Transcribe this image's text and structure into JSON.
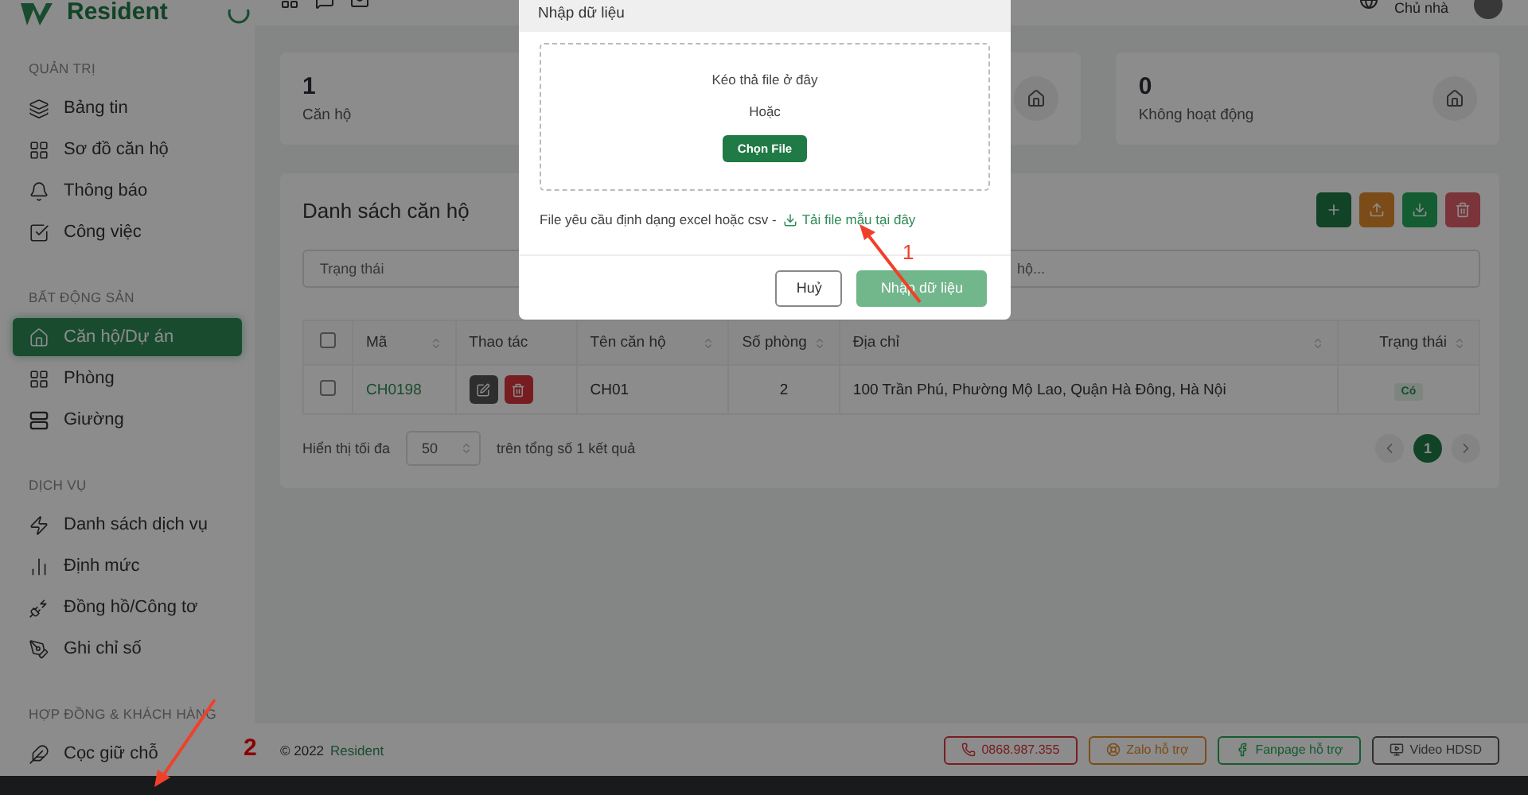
{
  "brand": {
    "name": "Resident"
  },
  "header": {
    "user_role": "Chủ nhà"
  },
  "sidebar": {
    "sections": [
      {
        "title": "QUẢN TRỊ",
        "items": [
          {
            "label": "Bảng tin",
            "selected": false
          },
          {
            "label": "Sơ đồ căn hộ",
            "selected": false
          },
          {
            "label": "Thông báo",
            "selected": false
          },
          {
            "label": "Công việc",
            "selected": false
          }
        ]
      },
      {
        "title": "BẤT ĐỘNG SẢN",
        "items": [
          {
            "label": "Căn hộ/Dự án",
            "selected": true
          },
          {
            "label": "Phòng",
            "selected": false
          },
          {
            "label": "Giường",
            "selected": false
          }
        ]
      },
      {
        "title": "DỊCH VỤ",
        "items": [
          {
            "label": "Danh sách dịch vụ",
            "selected": false
          },
          {
            "label": "Định mức",
            "selected": false
          },
          {
            "label": "Đồng hồ/Công tơ",
            "selected": false
          },
          {
            "label": "Ghi chỉ số",
            "selected": false
          }
        ]
      },
      {
        "title": "HỢP ĐỒNG & KHÁCH HÀNG",
        "items": [
          {
            "label": "Cọc giữ chỗ",
            "selected": false
          }
        ]
      }
    ]
  },
  "stats": [
    {
      "value": "1",
      "label": "Căn hộ"
    },
    {
      "value": "0",
      "label": "Không hoạt động"
    }
  ],
  "list": {
    "title": "Danh sách căn hộ",
    "actions": [
      {
        "kind": "add"
      },
      {
        "kind": "upload"
      },
      {
        "kind": "download"
      },
      {
        "kind": "delete"
      }
    ],
    "filter": {
      "placeholder": "Trạng thái"
    },
    "search": {
      "placeholder": "hộ..."
    },
    "columns": [
      {
        "label": "Mã",
        "sortable": true
      },
      {
        "label": "Thao tác",
        "sortable": false
      },
      {
        "label": "Tên căn hộ",
        "sortable": true
      },
      {
        "label": "Số phòng",
        "sortable": true
      },
      {
        "label": "Địa chỉ",
        "sortable": true
      },
      {
        "label": "Trạng thái",
        "sortable": true
      }
    ],
    "header_checked": false,
    "rows": [
      {
        "checked": false,
        "code": "CH0198",
        "name": "CH01",
        "rooms": "2",
        "address": "100 Trần Phú, Phường Mộ Lao, Quận Hà Đông, Hà Nội",
        "status": "Có"
      }
    ],
    "page_size_label": "Hiển thị tối đa",
    "page_size": "50",
    "total": "trên tổng số 1 kết quả",
    "pages": [
      {
        "label": "1",
        "selected": true
      }
    ]
  },
  "footer": {
    "copyright": "© 2022",
    "brand": "Resident",
    "links": [
      {
        "label": "0868.987.355",
        "kind": "phone"
      },
      {
        "label": "Zalo hỗ trợ",
        "kind": "support"
      },
      {
        "label": "Fanpage hỗ trợ",
        "kind": "facebook"
      },
      {
        "label": "Video HDSD",
        "kind": "video"
      }
    ]
  },
  "modal": {
    "title": "Nhập dữ liệu",
    "drop_text": "Kéo thả file ở đây",
    "or_text": "Hoặc",
    "choose_button": "Chọn File",
    "note": "File yêu cầu định dạng excel hoặc csv -",
    "template_link": "Tải file mẫu tại đây",
    "cancel_button": "Huỷ",
    "submit_button": "Nhập dữ liệu",
    "submit_disabled": true
  },
  "annotations": [
    {
      "label": "1"
    },
    {
      "label": "2"
    }
  ]
}
